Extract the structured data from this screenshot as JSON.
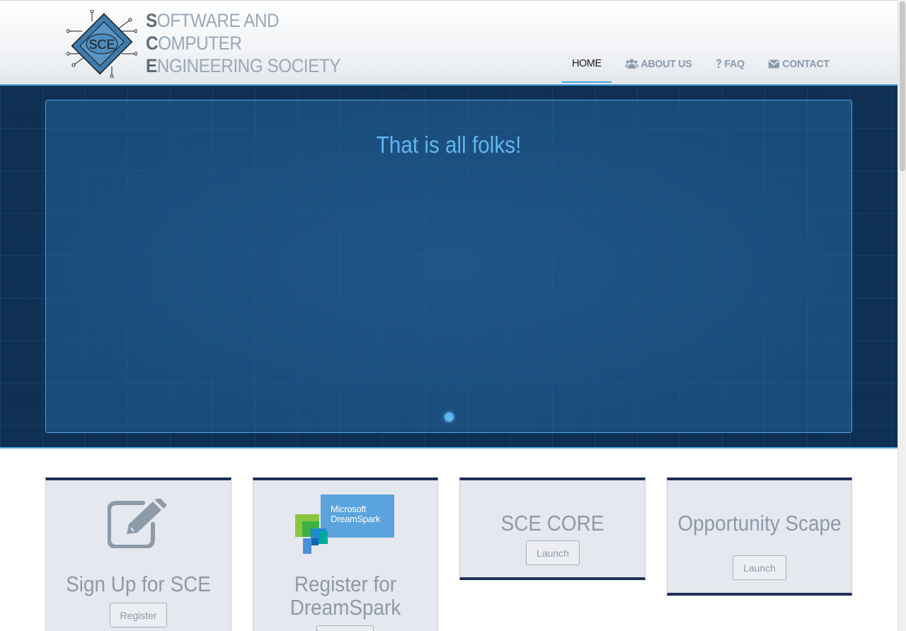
{
  "header": {
    "brand_line1_cap": "S",
    "brand_line1_rest": "OFTWARE AND",
    "brand_line2_cap": "C",
    "brand_line2_rest": "OMPUTER",
    "brand_line3_cap": "E",
    "brand_line3_rest": "NGINEERING SOCIETY",
    "logo_text": "SCE",
    "nav": [
      {
        "label": "HOME",
        "icon": "none",
        "active": true
      },
      {
        "label": "ABOUT US",
        "icon": "users-icon",
        "active": false
      },
      {
        "label": "FAQ",
        "icon": "question-icon",
        "active": false
      },
      {
        "label": "CONTACT",
        "icon": "envelope-icon",
        "active": false
      }
    ]
  },
  "hero": {
    "slide_title": "That is all folks!",
    "slide_count": 1,
    "active_slide": 1
  },
  "cards": [
    {
      "title": "Sign Up for SCE",
      "button": "Register",
      "icon": "pencil-square-icon"
    },
    {
      "title": "Register for DreamSpark",
      "button": "",
      "image_text_line1": "Microsoft",
      "image_text_line2": "DreamSpark"
    },
    {
      "title": "SCE CORE",
      "button": "Launch"
    },
    {
      "title": "Opportunity Scape",
      "button": "Launch"
    }
  ],
  "colors": {
    "accent": "#4aa3df",
    "card_border": "#1d2f58",
    "hero_bg": "#0e2f52",
    "muted_text": "#8d9aa9"
  }
}
